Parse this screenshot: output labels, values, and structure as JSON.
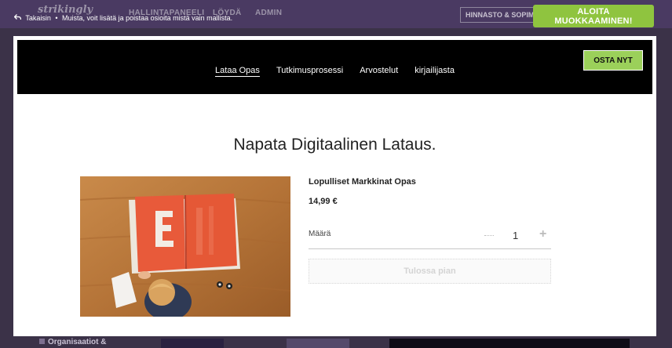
{
  "app_bar": {
    "logo": "strikingly",
    "nav_items": [
      "HALLINTAPANEELI",
      "LÖYDÄ",
      "ADMIN"
    ],
    "pricing_label": "HINNASTO & SOPIMUKSET",
    "back_label": "Takaisin",
    "separator": "•",
    "hint_text": "Muista, voit lisätä ja poistaa osioita mistä vain mallista.",
    "start_button": "ALOITA MUOKKAAMINEN!"
  },
  "site_preview": {
    "nav": [
      "Lataa Opas",
      "Tutkimusprosessi",
      "Arvostelut",
      "kirjailijasta"
    ],
    "active_nav": 0,
    "buy_button": "OSTA NYT",
    "title": "Napata Digitaalinen Lataus.",
    "product": {
      "name": "Lopulliset Markkinat Opas",
      "price": "14,99 €",
      "qty_label": "Määrä",
      "qty_value": "1",
      "soon_button": "Tulossa pian"
    }
  },
  "background": {
    "bottom_label": "Organisaatiot &"
  },
  "colors": {
    "accent_green": "#8fc43f",
    "buy_green": "#9bd05a",
    "app_bar": "#4a3a62"
  }
}
